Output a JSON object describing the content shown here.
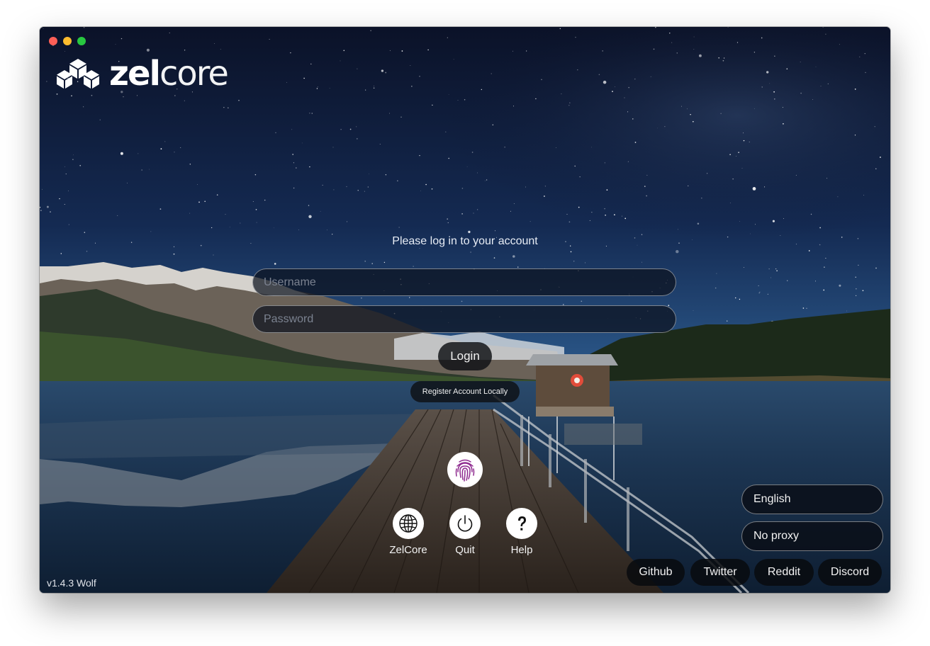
{
  "app": {
    "logo_text_bold": "zel",
    "logo_text_light": "core",
    "version": "v1.4.3 Wolf"
  },
  "login": {
    "prompt": "Please log in to your account",
    "username_placeholder": "Username",
    "username_value": "",
    "password_placeholder": "Password",
    "password_value": "",
    "login_label": "Login",
    "register_label": "Register Account Locally"
  },
  "actions": [
    {
      "label": "ZelCore",
      "icon": "globe-icon"
    },
    {
      "label": "Quit",
      "icon": "power-icon"
    },
    {
      "label": "Help",
      "icon": "question-icon"
    }
  ],
  "settings": {
    "language": "English",
    "proxy": "No proxy"
  },
  "links": {
    "github": "Github",
    "twitter": "Twitter",
    "reddit": "Reddit",
    "discord": "Discord"
  },
  "icons": {
    "fingerprint": "fingerprint-icon",
    "logo": "zelcore-cubes-logo"
  },
  "colors": {
    "traffic_close": "#fe5f57",
    "traffic_minimize": "#febc2e",
    "traffic_maximize": "#28c840",
    "fingerprint_accent": "#8e2a8f"
  }
}
